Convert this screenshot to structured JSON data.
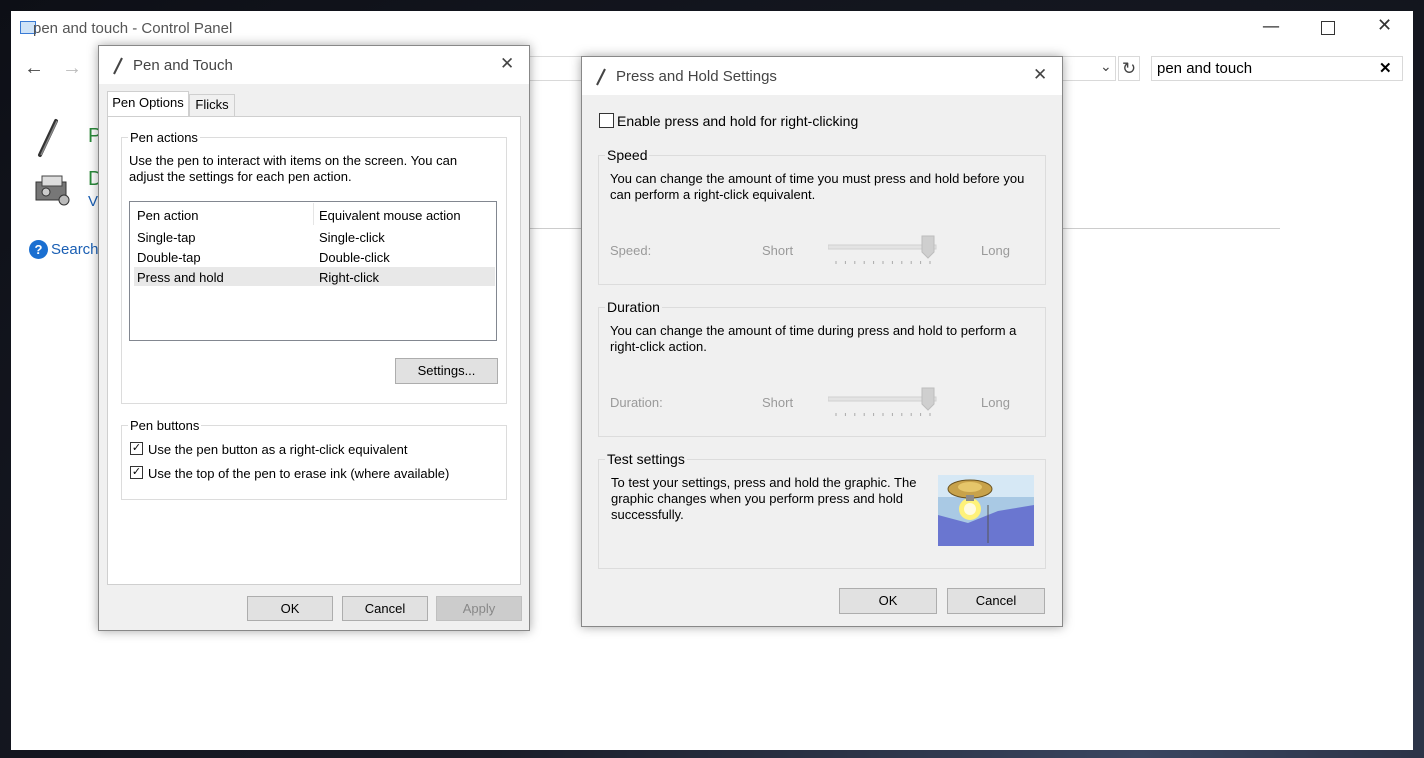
{
  "control_panel": {
    "title": "pen and touch - Control Panel",
    "search_value": "pen and touch",
    "items": [
      {
        "label": "P"
      },
      {
        "label": "D",
        "sub_label": "Vi"
      }
    ],
    "search_help": "Search"
  },
  "pen_and_touch": {
    "title": "Pen and Touch",
    "tabs": [
      "Pen Options",
      "Flicks"
    ],
    "pen_actions_group": "Pen actions",
    "pen_actions_desc": "Use the pen to interact with items on the screen.  You can adjust the settings for each pen action.",
    "table": {
      "headers": [
        "Pen action",
        "Equivalent mouse action"
      ],
      "rows": [
        [
          "Single-tap",
          "Single-click"
        ],
        [
          "Double-tap",
          "Double-click"
        ],
        [
          "Press and hold",
          "Right-click"
        ]
      ]
    },
    "settings_button": "Settings...",
    "pen_buttons_group": "Pen buttons",
    "checkbox1": "Use the pen button as a right-click equivalent",
    "checkbox2": "Use the top of the pen to erase ink (where available)",
    "ok": "OK",
    "cancel": "Cancel",
    "apply": "Apply"
  },
  "press_hold": {
    "title": "Press and Hold Settings",
    "enable_label": "Enable press and hold for right-clicking",
    "enable_checked": false,
    "speed_group": "Speed",
    "speed_desc": "You can change the amount of time you must press and hold before you can perform a right-click equivalent.",
    "speed_label": "Speed:",
    "speed_level": 1.0,
    "duration_group": "Duration",
    "duration_desc": "You can change the amount of time during press and hold to perform a right-click action.",
    "duration_label": "Duration:",
    "duration_level": 1.0,
    "short": "Short",
    "long": "Long",
    "test_group": "Test settings",
    "test_desc": "To test your settings, press and hold the graphic. The graphic changes when you perform press and hold successfully.",
    "ok": "OK",
    "cancel": "Cancel"
  }
}
